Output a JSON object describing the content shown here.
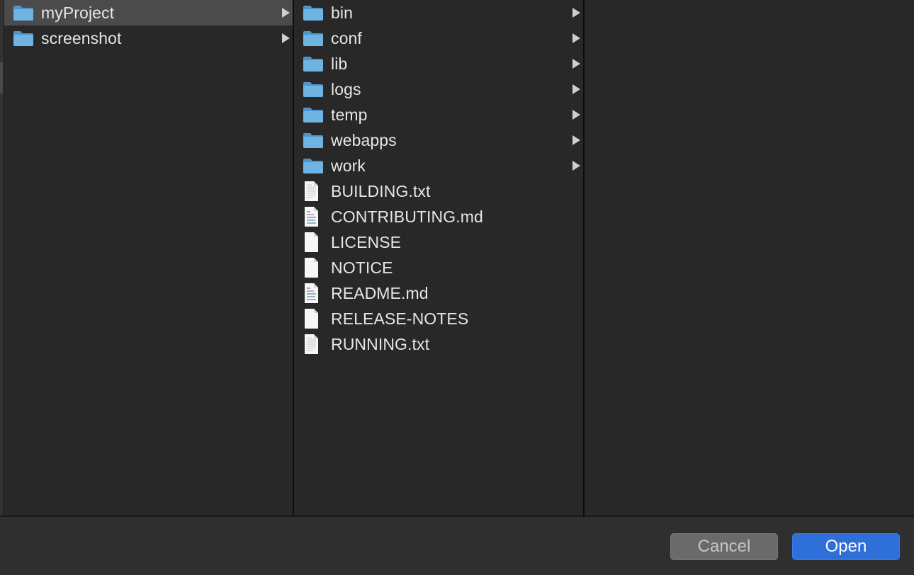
{
  "browser": {
    "column1": [
      {
        "name": "myProject",
        "kind": "folder",
        "selected": true,
        "has_children": true
      },
      {
        "name": "screenshot",
        "kind": "folder",
        "selected": false,
        "has_children": true
      }
    ],
    "column2": [
      {
        "name": "bin",
        "kind": "folder",
        "has_children": true
      },
      {
        "name": "conf",
        "kind": "folder",
        "has_children": true
      },
      {
        "name": "lib",
        "kind": "folder",
        "has_children": true
      },
      {
        "name": "logs",
        "kind": "folder",
        "has_children": true
      },
      {
        "name": "temp",
        "kind": "folder",
        "has_children": true
      },
      {
        "name": "webapps",
        "kind": "folder",
        "has_children": true
      },
      {
        "name": "work",
        "kind": "folder",
        "has_children": true
      },
      {
        "name": "BUILDING.txt",
        "kind": "text-file",
        "has_children": false
      },
      {
        "name": "CONTRIBUTING.md",
        "kind": "markdown-file",
        "has_children": false
      },
      {
        "name": "LICENSE",
        "kind": "blank-file",
        "has_children": false
      },
      {
        "name": "NOTICE",
        "kind": "blank-file",
        "has_children": false
      },
      {
        "name": "README.md",
        "kind": "markdown-file",
        "has_children": false
      },
      {
        "name": "RELEASE-NOTES",
        "kind": "blank-file",
        "has_children": false
      },
      {
        "name": "RUNNING.txt",
        "kind": "text-file",
        "has_children": false
      }
    ]
  },
  "footer": {
    "cancel_label": "Cancel",
    "open_label": "Open"
  },
  "colors": {
    "background": "#282828",
    "selected_row": "#4b4b4b",
    "folder": "#6fb3e3",
    "open_button": "#2e6fd9",
    "cancel_button": "#6a6a6a"
  }
}
